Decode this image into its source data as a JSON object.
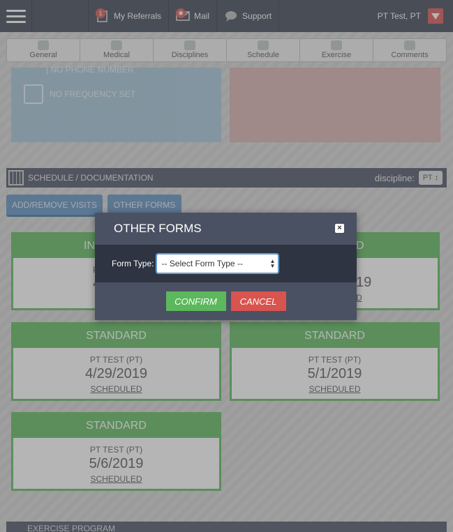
{
  "topbar": {
    "referrals_label": "My Referrals",
    "referrals_badge": "1",
    "mail_label": "Mail",
    "mail_badge": "✱",
    "support_label": "Support",
    "user_name": "PT Test, PT"
  },
  "tabs": [
    {
      "label": "General"
    },
    {
      "label": "Medical"
    },
    {
      "label": "Disciplines"
    },
    {
      "label": "Schedule"
    },
    {
      "label": "Exercise"
    },
    {
      "label": "Comments"
    }
  ],
  "info_card": {
    "phone": "| NO PHONE NUMBER",
    "frequency": "NO FREQUENCY SET"
  },
  "schedule_section": {
    "title": "SCHEDULE / DOCUMENTATION",
    "discipline_label": "discipline:",
    "discipline_value": "PT"
  },
  "actions": {
    "add_remove": "ADD/REMOVE VISITS",
    "other_forms": "OTHER FORMS"
  },
  "visits": [
    {
      "type": "IN",
      "name": "P",
      "date": "4/",
      "status": ""
    },
    {
      "type": "D",
      "name": "",
      "date": "19",
      "status": "D"
    },
    {
      "type": "STANDARD",
      "name": "PT TEST (PT)",
      "date": "4/29/2019",
      "status": "SCHEDULED"
    },
    {
      "type": "STANDARD",
      "name": "PT TEST (PT)",
      "date": "5/1/2019",
      "status": "SCHEDULED"
    },
    {
      "type": "STANDARD",
      "name": "PT TEST (PT)",
      "date": "5/6/2019",
      "status": "SCHEDULED"
    }
  ],
  "bottom_section": {
    "title": "EXERCISE PROGRAM"
  },
  "modal": {
    "title": "OTHER FORMS",
    "close": "×",
    "form_type_label": "Form Type:",
    "form_type_value": "-- Select Form Type --",
    "confirm": "CONFIRM",
    "cancel": "CANCEL"
  }
}
